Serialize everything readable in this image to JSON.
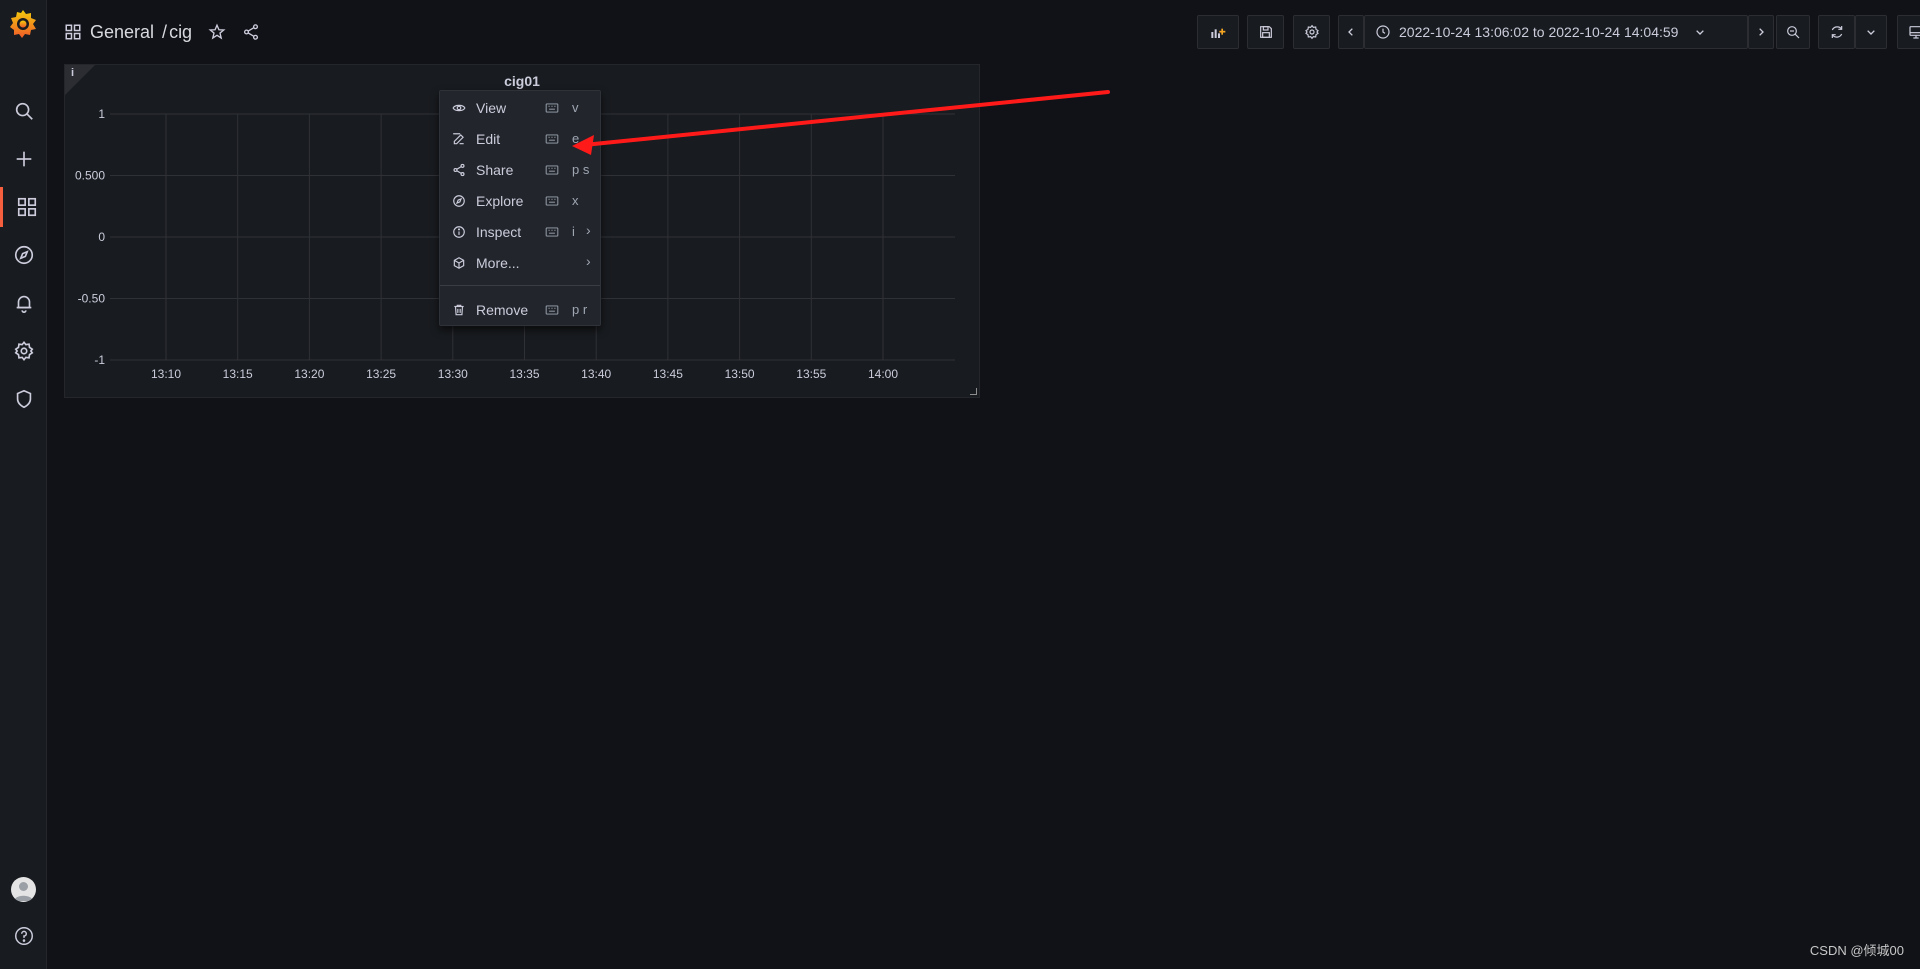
{
  "breadcrumb": {
    "folder": "General",
    "separator": "/",
    "dashboard": "cig"
  },
  "nav": {
    "time_range": "2022-10-24 13:06:02 to 2022-10-24 14:04:59",
    "add_panel_icon": "add-panel-icon",
    "save_icon": "save-icon",
    "settings_icon": "gear-icon",
    "refresh_icon": "refresh-icon",
    "tv_icon": "monitor-icon"
  },
  "sidebar": {
    "items": [
      "search-icon",
      "plus-icon",
      "dashboards-icon",
      "explore-icon",
      "alert-bell-icon",
      "gear-icon",
      "shield-icon"
    ],
    "active": "dashboards-icon",
    "bottom": [
      "avatar",
      "help-icon"
    ]
  },
  "panel": {
    "title": "cig01"
  },
  "chart_data": {
    "type": "line",
    "title": "cig01",
    "x": [
      "13:10",
      "13:15",
      "13:20",
      "13:25",
      "13:30",
      "13:35",
      "13:40",
      "13:45",
      "13:50",
      "13:55",
      "14:00"
    ],
    "y_ticks": [
      "1",
      "0.500",
      "0",
      "-0.50",
      "-1"
    ],
    "ylim": [
      -1,
      1
    ],
    "series": [],
    "grid": true,
    "legend": "none"
  },
  "menu": {
    "items": [
      {
        "label": "View",
        "shortcut": "v",
        "icon": "eye-icon"
      },
      {
        "label": "Edit",
        "shortcut": "e",
        "icon": "edit-icon"
      },
      {
        "label": "Share",
        "shortcut": "p s",
        "icon": "share-icon"
      },
      {
        "label": "Explore",
        "shortcut": "x",
        "icon": "compass-icon"
      },
      {
        "label": "Inspect",
        "shortcut": "i",
        "icon": "info-icon",
        "submenu": true
      },
      {
        "label": "More...",
        "shortcut": "",
        "icon": "cube-icon",
        "submenu": true
      }
    ],
    "remove": {
      "label": "Remove",
      "shortcut": "p r",
      "icon": "trash-icon"
    }
  },
  "annotation": {
    "color": "#ff1a1a"
  },
  "colors": {
    "accent": "#f55f3e",
    "background": "#111217",
    "panel": "#181b1f"
  },
  "watermark": "CSDN @倾城00"
}
